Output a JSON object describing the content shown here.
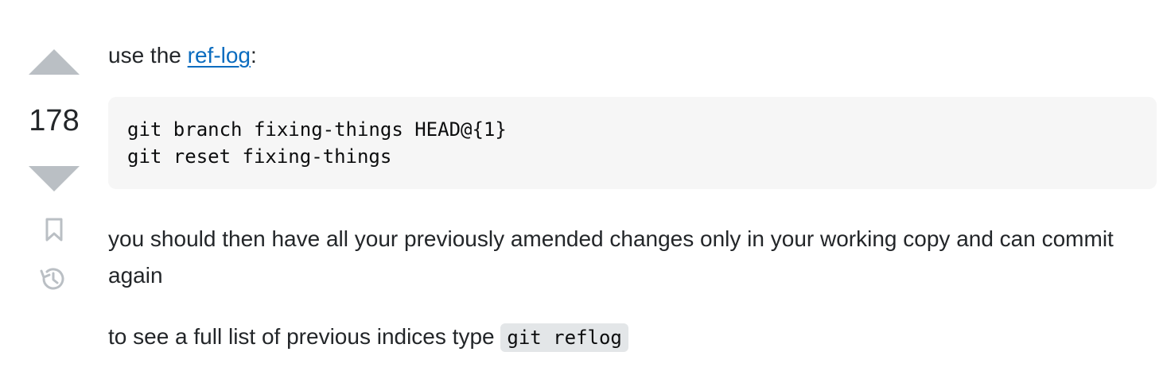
{
  "vote": {
    "count": "178",
    "up_icon": "triangle-up-icon",
    "down_icon": "triangle-down-icon",
    "bookmark_icon": "bookmark-icon",
    "history_icon": "history-icon",
    "icon_color": "#babfc4"
  },
  "post": {
    "p1_prefix": "use the ",
    "p1_link": "ref-log",
    "p1_suffix": ":",
    "code_lines": [
      "git branch fixing-things HEAD@{1}",
      "git reset fixing-things"
    ],
    "p2": "you should then have all your previously amended changes only in your working copy and can commit again",
    "p3_prefix": "to see a full list of previous indices type ",
    "p3_code": "git reflog"
  },
  "colors": {
    "link": "#0b6cbf",
    "code_bg": "#f6f6f6",
    "inline_code_bg": "#e3e6e8",
    "text": "#232629"
  }
}
